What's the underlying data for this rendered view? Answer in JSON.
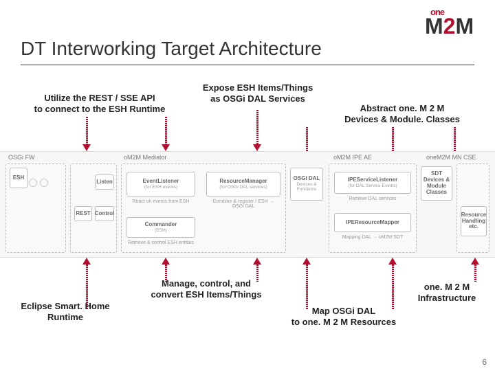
{
  "title": "DT Interworking Target Architecture",
  "logo": {
    "one_text": "one",
    "mm": "M",
    "two": "2",
    "mm2": "M"
  },
  "annotations": {
    "top_left": "Utilize the REST / SSE API\nto connect to the ESH Runtime",
    "top_mid": "Expose ESH Items/Things\nas OSGi DAL Services",
    "top_right": "Abstract one. M 2 M\nDevices & Module. Classes",
    "bottom_left": "Eclipse Smart. Home\nRuntime",
    "bottom_mid1": "Manage, control, and\nconvert ESH Items/Things",
    "bottom_mid2": "Map OSGi DAL\nto one. M 2 M Resources",
    "bottom_right": "one. M 2 M\nInfrastructure"
  },
  "band_labels": {
    "osgi": "OSGi FW",
    "mediator": "oM2M Mediator",
    "ipe": "oM2M IPE AE",
    "cse": "oneM2M MN CSE"
  },
  "boxes": {
    "esh": {
      "main": "ESH"
    },
    "rest": {
      "main": "REST"
    },
    "listen": {
      "main": "Listen"
    },
    "control": {
      "main": "Control"
    },
    "eventlistener": {
      "main": "EventListener",
      "sub": "(for ESH events)",
      "desc": "React on events from ESH"
    },
    "commander": {
      "main": "Commander",
      "sub": "(ESH)",
      "desc": "Retrieve & control ESH entities"
    },
    "resourcemgr": {
      "main": "ResourceManager",
      "sub": "(for OSGi DAL services)",
      "desc": "Combine & register / ESH → OSGi DAL"
    },
    "osgidal": {
      "main": "OSGi DAL",
      "sub": "Devices & Functions"
    },
    "ipeservice": {
      "main": "IPEServiceListener",
      "sub": "(for DAL Service Events)",
      "desc": "Retrieve DAL services"
    },
    "ipemapper": {
      "main": "IPEResourceMapper",
      "desc": "Mapping DAL → oM2M SDT"
    },
    "sdt": {
      "main": "SDT Devices & Module Classes"
    },
    "resource": {
      "main": "Resource Handling etc."
    }
  },
  "page_number": "6"
}
